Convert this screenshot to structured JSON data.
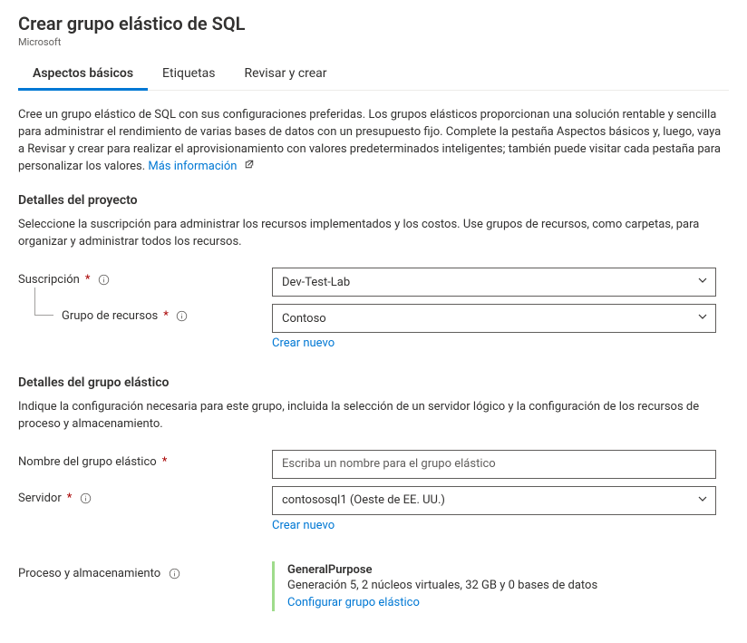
{
  "header": {
    "title": "Crear grupo elástico de SQL",
    "publisher": "Microsoft"
  },
  "tabs": {
    "basics": "Aspectos básicos",
    "tags": "Etiquetas",
    "review": "Revisar y crear"
  },
  "intro": {
    "text": "Cree un grupo elástico de SQL con sus configuraciones preferidas. Los grupos elásticos proporcionan una solución rentable y sencilla para administrar el rendimiento de varias bases de datos con un presupuesto fijo. Complete la pestaña Aspectos básicos y, luego, vaya a Revisar y crear para realizar el aprovisionamiento con valores predeterminados inteligentes; también puede visitar cada pestaña para personalizar los valores. ",
    "more_info": "Más información"
  },
  "project": {
    "title": "Detalles del proyecto",
    "text": "Seleccione la suscripción para administrar los recursos implementados y los costos. Use grupos de recursos, como carpetas, para organizar y administrar todos los recursos.",
    "subscription_label": "Suscripción",
    "subscription_value": "Dev-Test-Lab",
    "rg_label": "Grupo de recursos",
    "rg_value": "Contoso",
    "rg_create": "Crear nuevo"
  },
  "pool": {
    "title": "Detalles del grupo elástico",
    "text": "Indique la configuración necesaria para este grupo, incluida la selección de un servidor lógico y la configuración de los recursos de proceso y almacenamiento.",
    "name_label": "Nombre del grupo elástico",
    "name_placeholder": "Escriba un nombre para el grupo elástico",
    "server_label": "Servidor",
    "server_value": "contososql1 (Oeste de EE. UU.)",
    "server_create": "Crear nuevo",
    "compute_label": "Proceso y almacenamiento",
    "compute_tier": "GeneralPurpose",
    "compute_detail": "Generación 5, 2 núcleos virtuales, 32 GB y 0 bases de datos",
    "compute_configure": "Configurar grupo elástico"
  }
}
